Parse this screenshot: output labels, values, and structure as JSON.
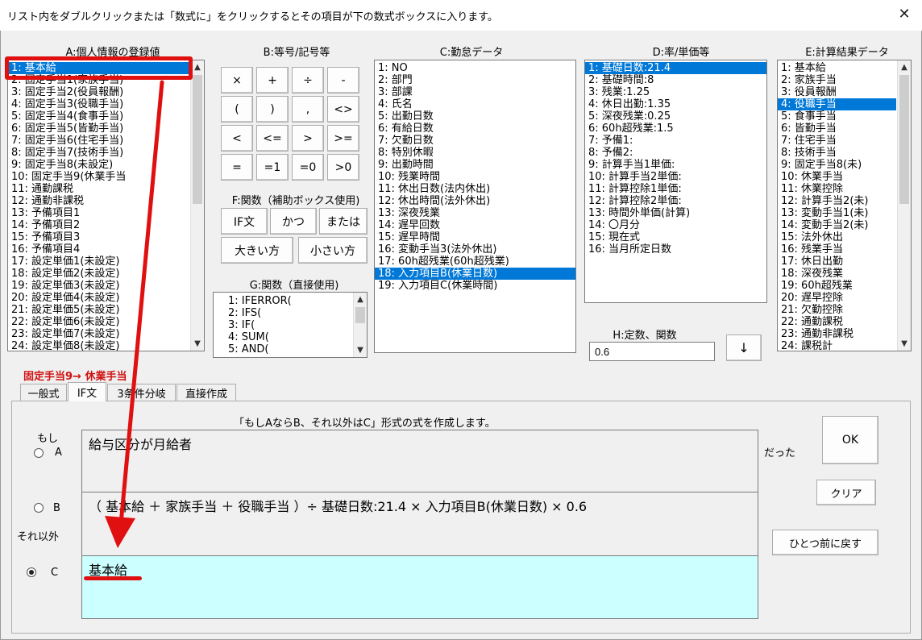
{
  "window": {
    "title": "リスト内をダブルクリックまたは「数式に」をクリックするとその項目が下の数式ボックスに入ります。",
    "close_glyph": "✕"
  },
  "sections": {
    "a": "A:個人情報の登録値",
    "b": "B:等号/記号等",
    "c": "C:勤怠データ",
    "d": "D:率/単価等",
    "e": "E:計算結果データ",
    "f": "F:関数（補助ボックス使用)",
    "g": "G:関数（直接使用)",
    "h": "H:定数、関数"
  },
  "list_a": {
    "selected_index": 0,
    "items": [
      "1: 基本給",
      "2: 固定手当1(家族手当)",
      "3: 固定手当2(役員報酬)",
      "4: 固定手当3(役職手当)",
      "5: 固定手当4(食事手当)",
      "6: 固定手当5(皆勤手当)",
      "7: 固定手当6(住宅手当)",
      "8: 固定手当7(技術手当)",
      "9: 固定手当8(未設定)",
      "10: 固定手当9(休業手当",
      "11: 通勤課税",
      "12: 通勤非課税",
      "13: 予備項目1",
      "14: 予備項目2",
      "15: 予備項目3",
      "16: 予備項目4",
      "17: 設定単価1(未設定)",
      "18: 設定単価2(未設定)",
      "19: 設定単価3(未設定)",
      "20: 設定単価4(未設定)",
      "21: 設定単価5(未設定)",
      "22: 設定単価6(未設定)",
      "23: 設定単価7(未設定)",
      "24: 設定単価8(未設定)"
    ]
  },
  "list_c": {
    "selected_index": 17,
    "items": [
      "1: NO",
      "2: 部門",
      "3: 部課",
      "4: 氏名",
      "5: 出勤日数",
      "6: 有給日数",
      "7: 欠勤日数",
      "8: 特別休暇",
      "9: 出勤時間",
      "10: 残業時間",
      "11: 休出日数(法内休出)",
      "12: 休出時間(法外休出)",
      "13: 深夜残業",
      "14: 遅早回数",
      "15: 遅早時間",
      "16: 変動手当3(法外休出)",
      "17: 60h超残業(60h超残業)",
      "18: 入力項目B(休業日数)",
      "19: 入力項目C(休業時間)"
    ]
  },
  "list_d": {
    "selected_index": 0,
    "items": [
      "1: 基礎日数:21.4",
      "2: 基礎時間:8",
      "3: 残業:1.25",
      "4: 休日出勤:1.35",
      "5: 深夜残業:0.25",
      "6: 60h超残業:1.5",
      "7: 予備1:",
      "8: 予備2:",
      "9: 計算手当1単価:",
      "10: 計算手当2単価:",
      "11: 計算控除1単価:",
      "12: 計算控除2単価:",
      "13: 時間外単価(計算)",
      "14: 〇月分",
      "15: 現在式",
      "16: 当月所定日数"
    ]
  },
  "list_e": {
    "selected_index": 3,
    "items": [
      "1: 基本給",
      "2: 家族手当",
      "3: 役員報酬",
      "4: 役職手当",
      "5: 食事手当",
      "6: 皆勤手当",
      "7: 住宅手当",
      "8: 技術手当",
      "9: 固定手当8(未)",
      "10: 休業手当",
      "11: 休業控除",
      "12: 計算手当2(未)",
      "13: 変動手当1(未)",
      "14: 変動手当2(未)",
      "15: 法外休出",
      "16: 残業手当",
      "17: 休日出勤",
      "18: 深夜残業",
      "19: 60h超残業",
      "20: 遅早控除",
      "21: 欠勤控除",
      "22: 通勤課税",
      "23: 通勤非課税",
      "24: 課税計"
    ]
  },
  "list_g": {
    "items": [
      "1: IFERROR(",
      "2: IFS(",
      "3: IF(",
      "4: SUM(",
      "5: AND("
    ]
  },
  "operators": [
    "×",
    "+",
    "÷",
    "-",
    "(",
    ")",
    ",",
    "<>",
    "<",
    "<=",
    ">",
    ">=",
    "=",
    "=1",
    "=0",
    ">0"
  ],
  "func_buttons": {
    "if": "IF文",
    "and": "かつ",
    "or": "または",
    "max": "大きい方",
    "min": "小さい方"
  },
  "constant_input": {
    "value": "0.6"
  },
  "insert_button": {
    "glyph": "↓"
  },
  "annotation": {
    "text": "固定手当9→ 休業手当"
  },
  "tabs": [
    "一般式",
    "IF文",
    "3条件分岐",
    "直接作成"
  ],
  "active_tab": 1,
  "if_panel": {
    "description": "「もしAならB、それ以外はC」形式の式を作成します。",
    "label_if": "もし",
    "label_a": "A",
    "label_b": "B",
    "label_else": "それ以外",
    "label_c": "C",
    "label_then": "だった",
    "box_a": "給与区分が月給者",
    "box_b": "（ 基本給 ＋ 家族手当 ＋ 役職手当 ）÷ 基礎日数:21.4 × 入力項目B(休業日数) × 0.6",
    "box_c": "基本給",
    "selected_radio": "c"
  },
  "buttons": {
    "ok": "OK",
    "clear": "クリア",
    "undo": "ひとつ前に戻す"
  },
  "colors": {
    "selection": "#0078d7",
    "box_c_bg": "#ccffff",
    "annotation_red": "#e01010"
  }
}
